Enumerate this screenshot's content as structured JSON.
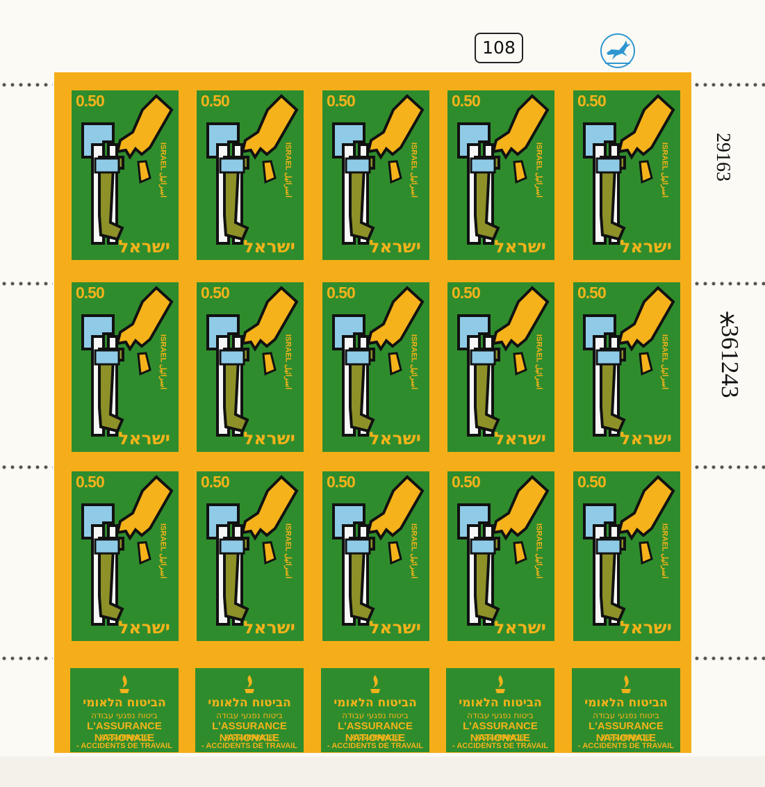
{
  "sheet": {
    "plate_number": "108",
    "control_number": "29163",
    "serial_number": "361243",
    "serial_mark": "*",
    "emblem_icon": "gazelle-emblem-icon"
  },
  "stamp": {
    "value": "0.50",
    "country_hebrew": "ישראל",
    "country_latin": "ISRAEL",
    "country_arabic": "اسرائيل",
    "colors": {
      "background": "#2f8c2d",
      "frame": "#f5ae19",
      "hand": "#f5b21a",
      "sleeve": "#8fcbe6",
      "arm": "#8d9128"
    }
  },
  "tab": {
    "hebrew_title": "הביטוח הלאומי",
    "hebrew_subtitle": "ביטוח נפגעי עבודה",
    "french_title": "L'ASSURANCE NATIONALE",
    "french_line2": "ASSURANCE",
    "french_line3": "- ACCIDENTS DE TRAVAIL",
    "flame_icon": "flame-emblem-icon"
  }
}
